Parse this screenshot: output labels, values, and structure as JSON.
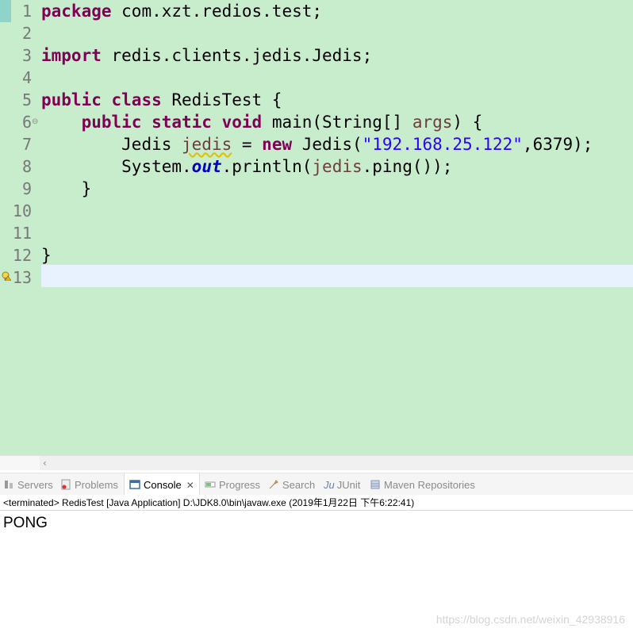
{
  "editor": {
    "line_numbers": [
      "1",
      "2",
      "3",
      "4",
      "5",
      "6",
      "7",
      "8",
      "9",
      "10",
      "11",
      "12",
      "13"
    ],
    "tokens": {
      "kw_package": "package",
      "pkg_name": " com.xzt.redios.test;",
      "kw_import": "import",
      "import_name": " redis.clients.jedis.Jedis;",
      "kw_public": "public",
      "kw_class": "class",
      "class_name": " RedisTest {",
      "indent1": "    ",
      "kw_public2": "public",
      "kw_static": "static",
      "kw_void": "void",
      "main_sig": " main(String[] ",
      "args": "args",
      "main_end": ") {",
      "indent2": "        ",
      "jedis_type": "Jedis ",
      "jedis_var": "jedis",
      "assign": " = ",
      "kw_new": "new",
      "ctor": " Jedis(",
      "host": "\"192.168.25.122\"",
      "port": ",6379);",
      "system": "System.",
      "out": "out",
      "println": ".println(",
      "jedis_ref": "jedis",
      "ping": ".ping());",
      "close_method": "    }",
      "close_class": "}"
    },
    "fold_glyph": "⊖"
  },
  "tabs": [
    {
      "label": "Servers",
      "icon": "servers-icon"
    },
    {
      "label": "Problems",
      "icon": "problems-icon"
    },
    {
      "label": "Console",
      "icon": "console-icon",
      "close": "✕"
    },
    {
      "label": "Progress",
      "icon": "progress-icon"
    },
    {
      "label": "Search",
      "icon": "search-icon"
    },
    {
      "label": "JUnit",
      "icon": "junit-icon",
      "prefix": "Ju"
    },
    {
      "label": "Maven Repositories",
      "icon": "maven-icon"
    }
  ],
  "console": {
    "header": "<terminated> RedisTest [Java Application] D:\\JDK8.0\\bin\\javaw.exe (2019年1月22日 下午6:22:41)",
    "output": "PONG"
  },
  "watermark": "https://blog.csdn.net/weixin_42938916",
  "colors": {
    "editor_bg": "#c7edcc",
    "keyword": "#7f0055",
    "string": "#2a00ff",
    "field": "#0000c0",
    "local_var": "#6a3e3e",
    "line_number": "#787878"
  }
}
